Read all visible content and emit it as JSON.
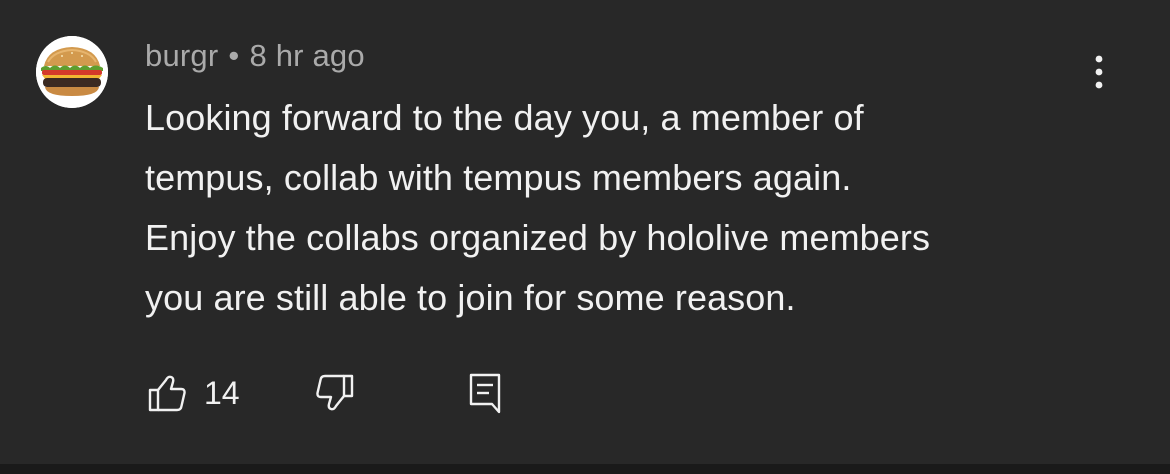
{
  "comment": {
    "author": "burgr",
    "separator": "•",
    "timestamp": "8 hr ago",
    "lines": [
      "Looking forward to the day you, a member of",
      "tempus, collab with tempus members again.",
      "Enjoy the collabs organized by hololive members",
      "you are still able to join for some reason."
    ],
    "like_count": "14"
  },
  "icons": {
    "avatar": "burger-avatar",
    "menu": "vertical-ellipsis-icon",
    "like": "thumbs-up-icon",
    "dislike": "thumbs-down-icon",
    "reply": "reply-comment-icon"
  },
  "colors": {
    "background": "#282828",
    "text_primary": "#f1f1f1",
    "text_secondary": "#aaaaaa"
  }
}
